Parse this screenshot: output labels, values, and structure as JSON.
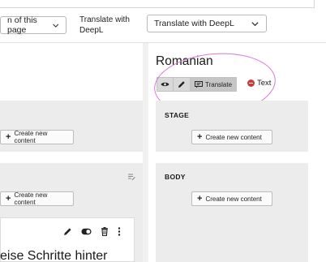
{
  "toolbar": {
    "position_select": "n of this page",
    "translate_label_line1": "Translate with",
    "translate_label_line2": "DeepL",
    "translate_select": "Translate with DeepL"
  },
  "language_column": {
    "title": "Romanian",
    "translate_button": "Translate",
    "status": "Text"
  },
  "sections": {
    "stage": {
      "title": "STAGE",
      "create_label": "Create new content"
    },
    "body": {
      "title": "BODY",
      "create_label": "Create new content"
    },
    "left_stage_create_label": "Create new content",
    "left_body_create_label": "Create new content"
  },
  "content_element": {
    "text": "eise Schritte hinter"
  },
  "colors": {
    "highlight": "#d57ad5",
    "status_dot": "#c83c3c"
  }
}
